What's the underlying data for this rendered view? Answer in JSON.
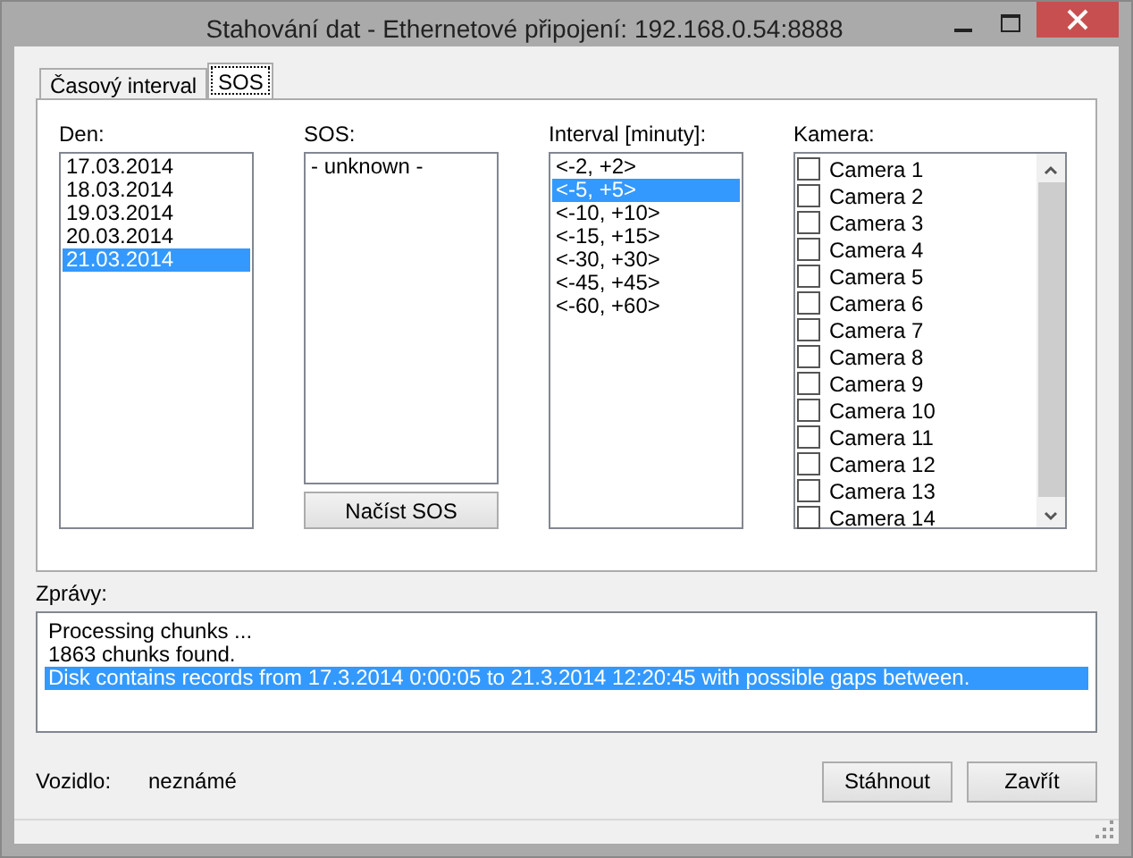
{
  "window": {
    "title": "Stahování dat - Ethernetové připojení: 192.168.0.54:8888"
  },
  "tabs": [
    {
      "label": "Časový interval",
      "selected": false
    },
    {
      "label": "SOS",
      "selected": true
    }
  ],
  "day": {
    "label": "Den:",
    "items": [
      {
        "text": "17.03.2014",
        "selected": false
      },
      {
        "text": "18.03.2014",
        "selected": false
      },
      {
        "text": "19.03.2014",
        "selected": false
      },
      {
        "text": "20.03.2014",
        "selected": false
      },
      {
        "text": "21.03.2014",
        "selected": true
      }
    ]
  },
  "sos": {
    "label": "SOS:",
    "items": [
      {
        "text": "- unknown -",
        "selected": false
      }
    ],
    "button": "Načíst SOS"
  },
  "interval": {
    "label": "Interval [minuty]:",
    "items": [
      {
        "text": "<-2, +2>",
        "selected": false
      },
      {
        "text": "<-5, +5>",
        "selected": true
      },
      {
        "text": "<-10, +10>",
        "selected": false
      },
      {
        "text": "<-15, +15>",
        "selected": false
      },
      {
        "text": "<-30, +30>",
        "selected": false
      },
      {
        "text": "<-45, +45>",
        "selected": false
      },
      {
        "text": "<-60, +60>",
        "selected": false
      }
    ]
  },
  "camera": {
    "label": "Kamera:",
    "items": [
      {
        "text": "Camera 1",
        "checked": false
      },
      {
        "text": "Camera 2",
        "checked": false
      },
      {
        "text": "Camera 3",
        "checked": false
      },
      {
        "text": "Camera 4",
        "checked": false
      },
      {
        "text": "Camera 5",
        "checked": false
      },
      {
        "text": "Camera 6",
        "checked": false
      },
      {
        "text": "Camera 7",
        "checked": false
      },
      {
        "text": "Camera 8",
        "checked": false
      },
      {
        "text": "Camera 9",
        "checked": false
      },
      {
        "text": "Camera 10",
        "checked": false
      },
      {
        "text": "Camera 11",
        "checked": false
      },
      {
        "text": "Camera 12",
        "checked": false
      },
      {
        "text": "Camera 13",
        "checked": false
      },
      {
        "text": "Camera 14",
        "checked": false
      }
    ]
  },
  "messages": {
    "label": "Zprávy:",
    "items": [
      {
        "text": "Processing chunks ...",
        "selected": false
      },
      {
        "text": "1863 chunks found.",
        "selected": false
      },
      {
        "text": "Disk contains records from 17.3.2014 0:00:05 to 21.3.2014 12:20:45 with possible gaps between.",
        "selected": true
      }
    ]
  },
  "vehicle": {
    "label": "Vozidlo:",
    "value": "neznámé"
  },
  "buttons": [
    "Stáhnout",
    "Zavřít"
  ]
}
